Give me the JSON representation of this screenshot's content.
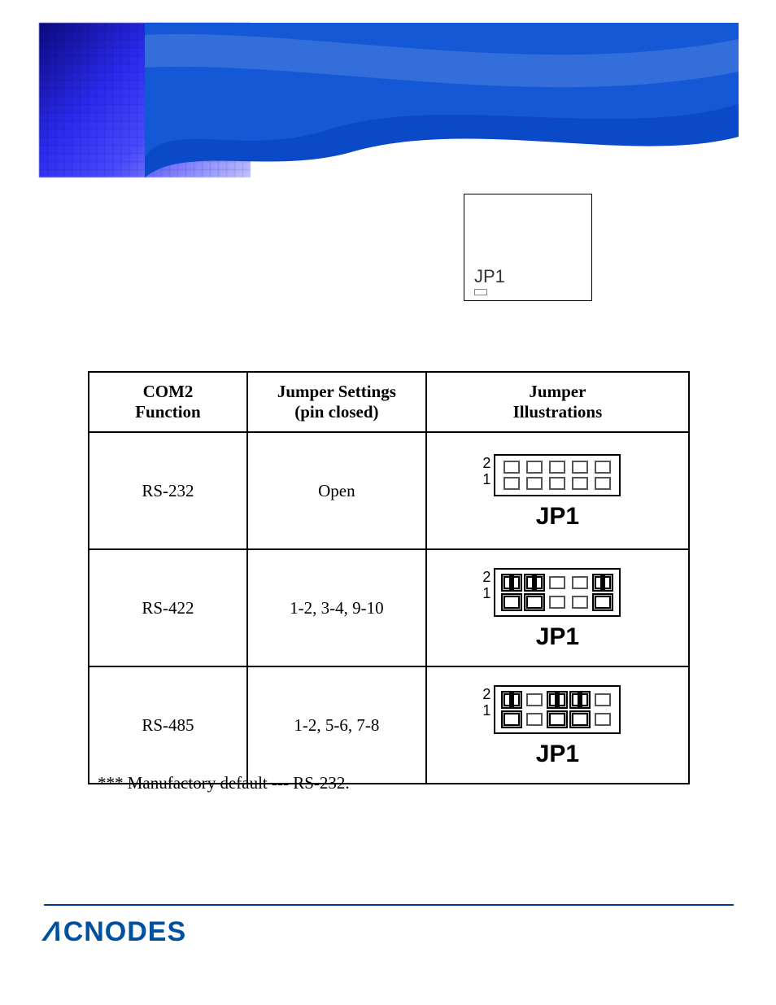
{
  "locator_label": "JP1",
  "table": {
    "headers": {
      "col1_line1": "COM2",
      "col1_line2": "Function",
      "col2_line1": "Jumper Settings",
      "col2_line2": "(pin closed)",
      "col3_line1": "Jumper",
      "col3_line2": "Illustrations"
    },
    "rows": [
      {
        "func": "RS-232",
        "setting": "Open",
        "row2": "2",
        "row1": "1",
        "jp": "JP1",
        "closed": []
      },
      {
        "func": "RS-422",
        "setting": "1-2, 3-4, 9-10",
        "row2": "2",
        "row1": "1",
        "jp": "JP1",
        "closed": [
          1,
          2,
          5
        ]
      },
      {
        "func": "RS-485",
        "setting": "1-2, 5-6, 7-8",
        "row2": "2",
        "row1": "1",
        "jp": "JP1",
        "closed": [
          1,
          3,
          4
        ]
      }
    ]
  },
  "footnote": "*** Manufactory default --- RS-232.",
  "logo_text": "CNODES"
}
